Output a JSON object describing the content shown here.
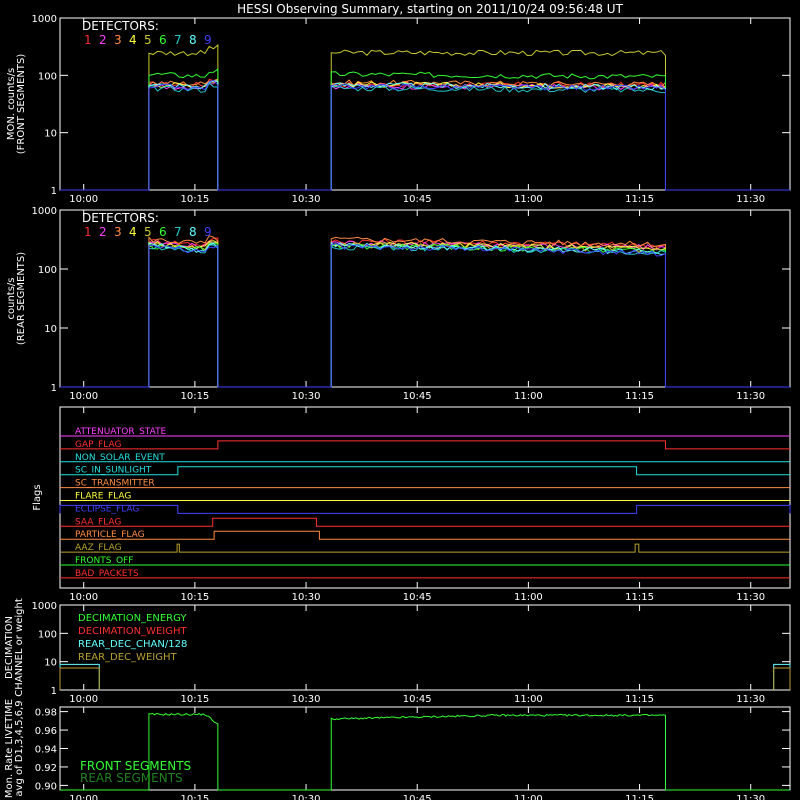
{
  "title": "HESSI Observing Summary, starting on 2011/10/24 09:56:48 UT",
  "colors": {
    "d1": "#ff3030",
    "d2": "#ff40ff",
    "d3": "#ff8c40",
    "d4": "#ffff40",
    "d5": "#c8c830",
    "d6": "#30ff30",
    "d7": "#20c8c8",
    "d8": "#60ffff",
    "d9": "#4040ff",
    "gold": "#b8a030",
    "frame": "#ffffff"
  },
  "x_ticks": [
    "10:00",
    "10:15",
    "10:30",
    "10:45",
    "11:00",
    "11:15",
    "11:30"
  ],
  "x_tick_minutes": [
    3.2,
    18.2,
    33.2,
    48.2,
    63.2,
    78.2,
    93.2
  ],
  "x_range": [
    0,
    98.5
  ],
  "detector_legend": {
    "title": "DETECTORS:",
    "numbers": [
      "1",
      "2",
      "3",
      "4",
      "5",
      "6",
      "7",
      "8",
      "9"
    ]
  },
  "chart_data": [
    {
      "type": "line",
      "ylabel": "MON. counts/s\n(FRONT SEGMENTS)",
      "yscale": "log",
      "ylim": [
        1,
        1000
      ],
      "y_ticks": [
        "1",
        "10",
        "100",
        "1000"
      ],
      "intervals_minutes": [
        [
          12.0,
          21.3
        ],
        [
          36.6,
          81.7
        ]
      ],
      "series": [
        {
          "name": "1",
          "level": [
            70,
            68
          ]
        },
        {
          "name": "2",
          "level": [
            65,
            62
          ]
        },
        {
          "name": "3",
          "level": [
            75,
            70
          ]
        },
        {
          "name": "4",
          "level": [
            70,
            65
          ]
        },
        {
          "name": "5",
          "level": [
            250,
            245
          ]
        },
        {
          "name": "6",
          "level": [
            105,
            95
          ]
        },
        {
          "name": "7",
          "level": [
            60,
            55
          ]
        },
        {
          "name": "8",
          "level": [
            68,
            62
          ]
        },
        {
          "name": "9",
          "level": [
            65,
            60
          ]
        }
      ]
    },
    {
      "type": "line",
      "ylabel": "counts/s\n(REAR SEGMENTS)",
      "yscale": "log",
      "ylim": [
        1,
        1000
      ],
      "y_ticks": [
        "1",
        "10",
        "100",
        "1000"
      ],
      "intervals_minutes": [
        [
          12.0,
          21.3
        ],
        [
          36.6,
          81.7
        ]
      ],
      "series": [
        {
          "name": "1",
          "level": [
            300,
            250
          ]
        },
        {
          "name": "2",
          "level": [
            280,
            230
          ]
        },
        {
          "name": "3",
          "level": [
            320,
            260
          ]
        },
        {
          "name": "4",
          "level": [
            270,
            220
          ]
        },
        {
          "name": "5",
          "level": [
            260,
            210
          ]
        },
        {
          "name": "6",
          "level": [
            250,
            200
          ]
        },
        {
          "name": "7",
          "level": [
            240,
            190
          ]
        },
        {
          "name": "8",
          "level": [
            255,
            195
          ]
        },
        {
          "name": "9",
          "level": [
            245,
            185
          ]
        }
      ]
    },
    {
      "type": "line",
      "ylabel": "Flags",
      "flags": [
        {
          "label": "ATTENUATOR_STATE",
          "color": "#ff40ff",
          "on": []
        },
        {
          "label": "GAP_FLAG",
          "color": "#ff3030",
          "on": [
            [
              21.3,
              81.7
            ]
          ]
        },
        {
          "label": "NON_SOLAR_EVENT",
          "color": "#20e0e0",
          "on": []
        },
        {
          "label": "SC_IN_SUNLIGHT",
          "color": "#20e0e0",
          "on": [
            [
              15.9,
              77.8
            ]
          ]
        },
        {
          "label": "SC_TRANSMITTER",
          "color": "#ff8c40",
          "on": []
        },
        {
          "label": "FLARE_FLAG",
          "color": "#ffff40",
          "on": []
        },
        {
          "label": "ECLIPSE_FLAG",
          "color": "#4040ff",
          "on": [
            [
              0,
              15.9
            ],
            [
              77.8,
              98.5
            ]
          ]
        },
        {
          "label": "SAA_FLAG",
          "color": "#ff3030",
          "on": [
            [
              20.6,
              34.6
            ]
          ]
        },
        {
          "label": "PARTICLE_FLAG",
          "color": "#ff8c40",
          "on": [
            [
              20.8,
              35.0
            ]
          ]
        },
        {
          "label": "AAZ_FLAG",
          "color": "#b8a030",
          "on": [
            [
              15.8,
              16.1
            ],
            [
              77.6,
              78.1
            ]
          ]
        },
        {
          "label": "FRONTS_OFF",
          "color": "#30ff30",
          "on": []
        },
        {
          "label": "BAD_PACKETS",
          "color": "#ff3030",
          "on": []
        }
      ]
    },
    {
      "type": "line",
      "ylabel": "DECIMATION\nCHANNEL or weight",
      "yscale": "log",
      "ylim": [
        1,
        1000
      ],
      "y_ticks": [
        "1",
        "10",
        "100",
        "1000"
      ],
      "legend": [
        {
          "label": "DECIMATION_ENERGY",
          "color": "#30ff30"
        },
        {
          "label": "DECIMATION_WEIGHT",
          "color": "#ff3030"
        },
        {
          "label": "REAR_DEC_CHAN/128",
          "color": "#60ffff"
        },
        {
          "label": "REAR_DEC_WEIGHT",
          "color": "#b8a030"
        }
      ],
      "series": [
        {
          "name": "REAR_DEC_CHAN/128",
          "segments": [
            [
              0,
              5.3,
              8
            ],
            [
              96.3,
              98.5,
              8
            ]
          ]
        },
        {
          "name": "REAR_DEC_WEIGHT",
          "segments": [
            [
              0,
              5.3,
              6
            ],
            [
              96.3,
              98.5,
              6
            ]
          ]
        }
      ]
    },
    {
      "type": "line",
      "ylabel": "Mon. Rate LIVETIME\navg of D1,3,4,5,6,9",
      "ylim": [
        0.895,
        0.985
      ],
      "y_ticks": [
        "0.90",
        "0.92",
        "0.94",
        "0.96",
        "0.98"
      ],
      "y_tick_values": [
        0.9,
        0.92,
        0.94,
        0.96,
        0.98
      ],
      "legend": [
        {
          "label": "FRONT SEGMENTS",
          "color": "#30ff30"
        },
        {
          "label": "REAR SEGMENTS",
          "color": "#208020"
        }
      ],
      "series": [
        {
          "name": "FRONT SEGMENTS",
          "intervals_minutes": [
            [
              12.0,
              21.3
            ],
            [
              36.6,
              81.7
            ]
          ],
          "level": [
            0.977,
            0.976
          ]
        }
      ]
    }
  ]
}
